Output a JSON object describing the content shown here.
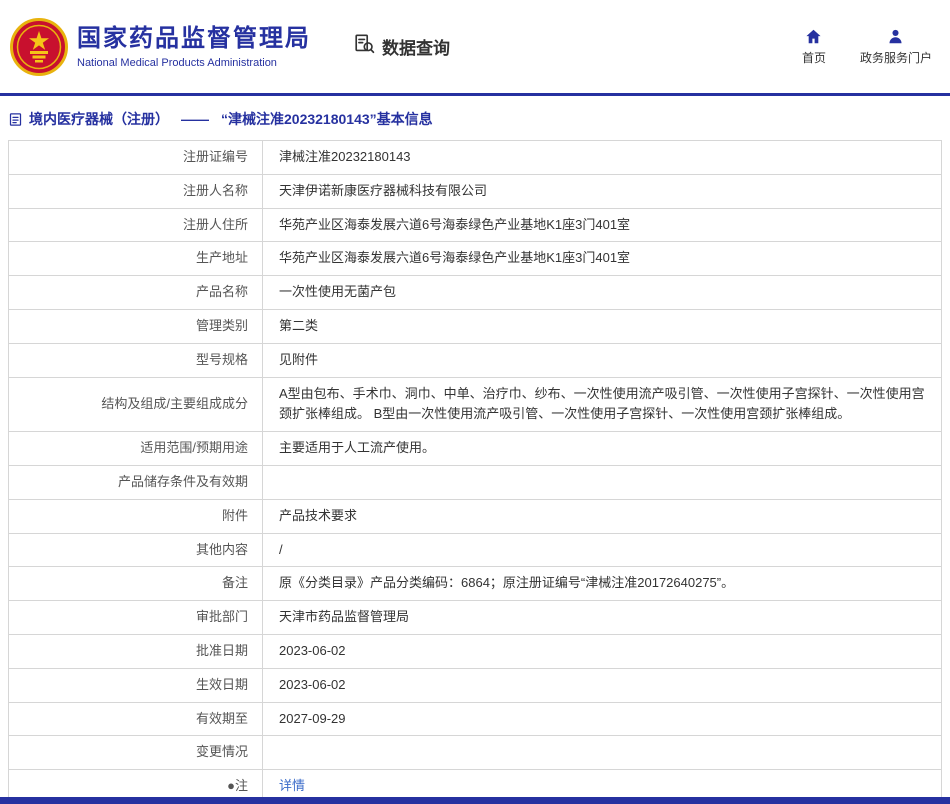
{
  "colors": {
    "brand_blue": "#2631a0",
    "link_blue": "#3a6bc9",
    "border_gray": "#d6d6d6",
    "emblem_red": "#c8102e",
    "emblem_gold": "#e8b30e"
  },
  "icons": {
    "emblem": "national-emblem-icon",
    "data_query": "document-magnifier-icon",
    "home": "home-icon",
    "portal": "user-icon",
    "breadcrumb_doc": "document-icon",
    "note_bullet": "●"
  },
  "header": {
    "site_name": "国家药品监督管理局",
    "site_subtitle": "National Medical Products Administration",
    "section_label": "数据查询",
    "nav": [
      {
        "label": "首页"
      },
      {
        "label": "政务服务门户"
      }
    ]
  },
  "breadcrumb": {
    "category": "境内医疗器械（注册）",
    "separator": "——",
    "title": "“津械注准20232180143”基本信息"
  },
  "table": {
    "rows": [
      {
        "label": "注册证编号",
        "value": "津械注准20232180143"
      },
      {
        "label": "注册人名称",
        "value": "天津伊诺新康医疗器械科技有限公司"
      },
      {
        "label": "注册人住所",
        "value": "华苑产业区海泰发展六道6号海泰绿色产业基地K1座3门401室"
      },
      {
        "label": "生产地址",
        "value": "华苑产业区海泰发展六道6号海泰绿色产业基地K1座3门401室"
      },
      {
        "label": "产品名称",
        "value": "一次性使用无菌产包"
      },
      {
        "label": "管理类别",
        "value": "第二类"
      },
      {
        "label": "型号规格",
        "value": "见附件"
      },
      {
        "label": "结构及组成/主要组成成分",
        "value": "A型由包布、手术巾、洞巾、中单、治疗巾、纱布、一次性使用流产吸引管、一次性使用子宫探针、一次性使用宫颈扩张棒组成。 B型由一次性使用流产吸引管、一次性使用子宫探针、一次性使用宫颈扩张棒组成。"
      },
      {
        "label": "适用范围/预期用途",
        "value": "主要适用于人工流产使用。"
      },
      {
        "label": "产品储存条件及有效期",
        "value": ""
      },
      {
        "label": "附件",
        "value": "产品技术要求"
      },
      {
        "label": "其他内容",
        "value": "/"
      },
      {
        "label": "备注",
        "value": "原《分类目录》产品分类编码：6864；原注册证编号“津械注准20172640275”。"
      },
      {
        "label": "审批部门",
        "value": "天津市药品监督管理局"
      },
      {
        "label": "批准日期",
        "value": "2023-06-02"
      },
      {
        "label": "生效日期",
        "value": "2023-06-02"
      },
      {
        "label": "有效期至",
        "value": "2027-09-29"
      },
      {
        "label": "变更情况",
        "value": ""
      },
      {
        "label": "●注",
        "value": "详情",
        "link": true
      }
    ]
  }
}
